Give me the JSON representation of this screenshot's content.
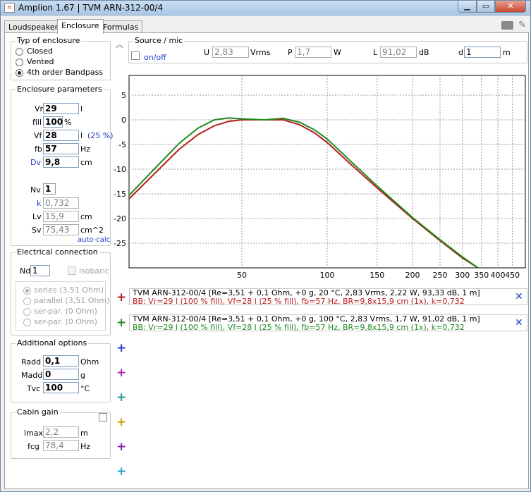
{
  "window": {
    "title": "Amplion 1.67 | TVM ARN-312-00/4",
    "app_icon": "app-icon"
  },
  "tabs": [
    {
      "label": "Loudspeaker"
    },
    {
      "label": "Enclosure"
    },
    {
      "label": "Formulas"
    }
  ],
  "enclosure_type": {
    "title": "Typ of enclosure",
    "options": [
      {
        "label": "Closed"
      },
      {
        "label": "Vented"
      },
      {
        "label": "4th order Bandpass"
      }
    ],
    "selected": "4th order Bandpass"
  },
  "enclosure_params": {
    "title": "Enclosure parameters",
    "vr": {
      "label": "Vr",
      "value": "29",
      "unit": "l"
    },
    "fill": {
      "label": "fill",
      "value": "100",
      "unit": "%"
    },
    "vf": {
      "label": "Vf",
      "value": "28",
      "unit": "l",
      "extra": "(25 %)"
    },
    "fb": {
      "label": "fb",
      "value": "57",
      "unit": "Hz"
    },
    "dv": {
      "label": "Dv",
      "value": "9,8",
      "unit": "cm"
    },
    "nv": {
      "label": "Nv",
      "value": "1"
    },
    "k": {
      "label": "k",
      "value": "0,732"
    },
    "lv": {
      "label": "Lv",
      "value": "15,9",
      "unit": "cm"
    },
    "sv": {
      "label": "Sv",
      "value": "75,43",
      "unit": "cm^2"
    },
    "auto_calc": "auto-calc"
  },
  "electrical": {
    "title": "Electrical connection",
    "nd": {
      "label": "Nd",
      "value": "1"
    },
    "isobaric": "isobaric",
    "options": [
      {
        "label": "series (3,51 Ohm)"
      },
      {
        "label": "parallel (3,51 Ohm)"
      },
      {
        "label": "ser-par. (0 Ohm)"
      },
      {
        "label": "ser-par. (0 Ohm)"
      }
    ]
  },
  "additional": {
    "title": "Additional options",
    "radd": {
      "label": "Radd",
      "value": "0,1",
      "unit": "Ohm"
    },
    "madd": {
      "label": "Madd",
      "value": "0",
      "unit": "g"
    },
    "tvc": {
      "label": "Tvc",
      "value": "100",
      "unit": "°C"
    }
  },
  "cabin": {
    "title": "Cabin gain",
    "lmax": {
      "label": "lmax",
      "value": "2,2",
      "unit": "m"
    },
    "fcg": {
      "label": "fcg",
      "value": "78,4",
      "unit": "Hz"
    }
  },
  "source": {
    "title": "Source / mic",
    "onoff": "on/off",
    "u": {
      "label": "U",
      "value": "2,83",
      "unit": "Vrms"
    },
    "p": {
      "label": "P",
      "value": "1,7",
      "unit": "W"
    },
    "l": {
      "label": "L",
      "value": "91,02",
      "unit": "dB"
    },
    "d": {
      "label": "d",
      "value": "1",
      "unit": "m"
    }
  },
  "curves": [
    {
      "line1": "TVM ARN-312-00/4 [Re=3,51 + 0,1 Ohm, +0 g, 20 °C, 2,83 Vrms, 2,22 W, 93,33 dB, 1 m]",
      "line2": "BB: Vr=29 l (100 % fill), Vf=28 l (25 % fill), fb=57 Hz, BR=9,8x15,9 cm (1x), k=0,732",
      "color": "#b81c1c"
    },
    {
      "line1": "TVM ARN-312-00/4 [Re=3,51 + 0,1 Ohm, +0 g, 100 °C, 2,83 Vrms, 1,7 W, 91,02 dB, 1 m]",
      "line2": "BB: Vr=29 l (100 % fill), Vf=28 l (25 % fill), fb=57 Hz, BR=9,8x15,9 cm (1x), k=0,732",
      "color": "#1f8a1f"
    }
  ],
  "plus_colors": [
    "#b81c1c",
    "#1f8a1f",
    "#1e3cc8",
    "#b020b0",
    "#1a9a9a",
    "#c89a10",
    "#8a20b0",
    "#2aa0c0"
  ],
  "chart_data": {
    "type": "line",
    "x_scale": "log",
    "xlim": [
      20,
      500
    ],
    "ylim": [
      -30,
      9
    ],
    "x_ticks": [
      50,
      100,
      150,
      200,
      250,
      300,
      350,
      400,
      450
    ],
    "y_ticks": [
      5,
      0,
      -5,
      -10,
      -15,
      -20,
      -25
    ],
    "grid": true,
    "series": [
      {
        "color": "#b81c1c",
        "x": [
          20,
          25,
          30,
          35,
          40,
          45,
          50,
          60,
          70,
          80,
          90,
          100,
          120,
          150,
          200,
          250,
          300,
          340
        ],
        "y": [
          -16,
          -10.5,
          -6,
          -3,
          -1.2,
          -0.3,
          0,
          0,
          0,
          -1,
          -2.6,
          -4.6,
          -8.8,
          -13.8,
          -20,
          -24.5,
          -28,
          -30
        ]
      },
      {
        "color": "#1f8a1f",
        "x": [
          20,
          25,
          30,
          35,
          40,
          45,
          50,
          60,
          70,
          80,
          90,
          100,
          120,
          150,
          200,
          250,
          300,
          340
        ],
        "y": [
          -15.3,
          -9.5,
          -4.8,
          -1.7,
          0,
          0.4,
          0.2,
          0,
          0.3,
          -0.5,
          -2,
          -3.9,
          -8.2,
          -13.4,
          -19.8,
          -24.3,
          -27.8,
          -30
        ]
      }
    ]
  }
}
